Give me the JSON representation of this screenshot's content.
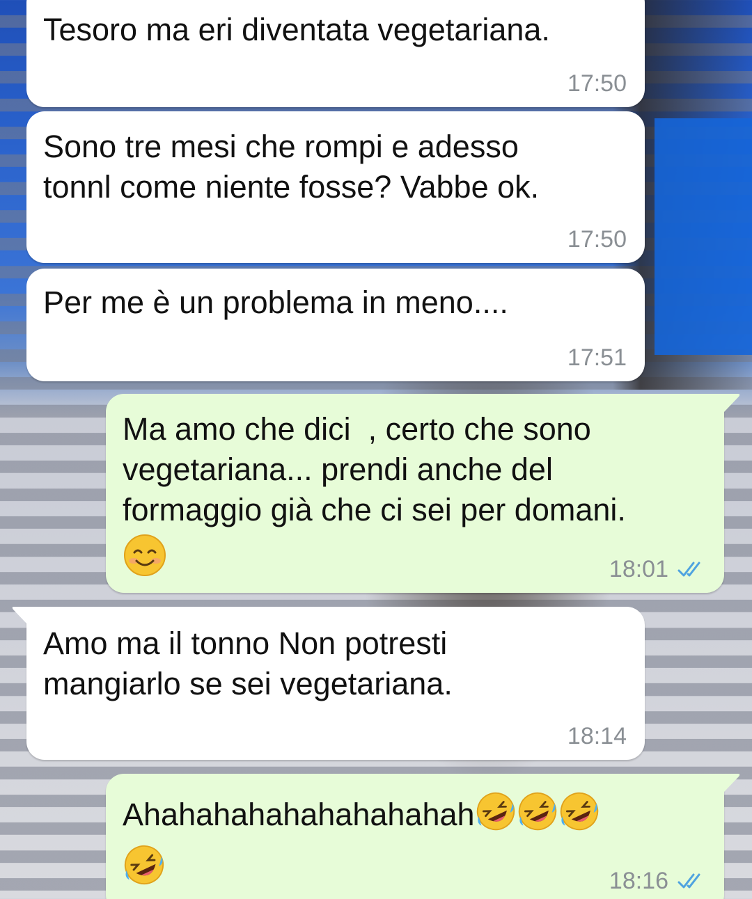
{
  "messages": [
    {
      "direction": "in",
      "text": "Tesoro ma eri diventata vegetariana.",
      "time": "17:50"
    },
    {
      "direction": "in",
      "text": "Sono tre mesi che rompi e adesso\ntonnl come niente fosse? Vabbe ok.",
      "time": "17:50"
    },
    {
      "direction": "in",
      "text": "Per me è un problema in meno....",
      "time": "17:51"
    },
    {
      "direction": "out",
      "text": "Ma amo che dici  , certo che sono\nvegetariana... prendi anche del\nformaggio già che ci sei per domani.",
      "emoji": "smiling-face-icon",
      "time": "18:01",
      "status": "read"
    },
    {
      "direction": "in",
      "text": "Amo ma il tonno Non potresti\nmangiarlo se sei vegetariana.",
      "time": "18:14"
    },
    {
      "direction": "out",
      "text": "Ahahahahahahahahahah",
      "emoji": "rolling-on-floor-laughing-icon",
      "time": "18:16",
      "status": "read"
    }
  ],
  "colors": {
    "incoming_bubble": "#ffffff",
    "outgoing_bubble": "#e7fcd8",
    "timestamp": "#8a8f94",
    "read_ticks": "#4fa3e0"
  }
}
